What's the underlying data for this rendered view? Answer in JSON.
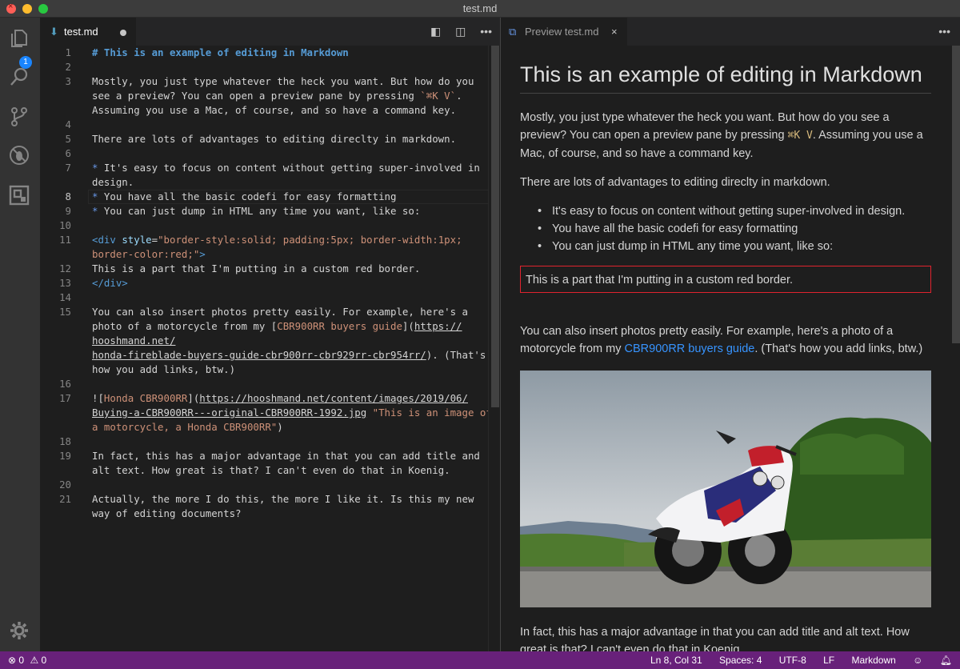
{
  "window": {
    "title": "test.md"
  },
  "activity_bar": {
    "explorer_badge": "1",
    "icons": [
      "files-icon",
      "search-icon",
      "source-control-icon",
      "debug-icon",
      "extensions-icon",
      "gear-icon"
    ]
  },
  "editor": {
    "tab": {
      "label": "test.md",
      "icon": "markdown-icon",
      "dirty": true
    },
    "actions": [
      "open-preview-side-icon",
      "split-editor-icon",
      "more-actions-icon"
    ],
    "current_line": "8",
    "lines": [
      {
        "n": "1",
        "segs": [
          {
            "c": "h1",
            "t": "# This is an example of editing in Markdown"
          }
        ]
      },
      {
        "n": "2",
        "segs": []
      },
      {
        "n": "3",
        "segs": [
          {
            "c": "",
            "t": "Mostly, you just type whatever the heck you want. But how do you"
          }
        ]
      },
      {
        "n": "",
        "segs": [
          {
            "c": "",
            "t": "see a preview? You can open a preview pane by pressing "
          },
          {
            "c": "codei",
            "t": "`⌘K V`"
          },
          {
            "c": "",
            "t": "."
          }
        ]
      },
      {
        "n": "",
        "segs": [
          {
            "c": "",
            "t": "Assuming you use a Mac, of course, and so have a command key."
          }
        ]
      },
      {
        "n": "4",
        "segs": []
      },
      {
        "n": "5",
        "segs": [
          {
            "c": "",
            "t": "There are lots of advantages to editing direclty in markdown."
          }
        ]
      },
      {
        "n": "6",
        "segs": []
      },
      {
        "n": "7",
        "segs": [
          {
            "c": "li",
            "t": "*"
          },
          {
            "c": "",
            "t": " It's easy to focus on content without getting super-involved in"
          }
        ]
      },
      {
        "n": "",
        "segs": [
          {
            "c": "",
            "t": "design."
          }
        ]
      },
      {
        "n": "8",
        "segs": [
          {
            "c": "li",
            "t": "*"
          },
          {
            "c": "",
            "t": " You have all the basic codefi for easy formatting"
          }
        ]
      },
      {
        "n": "9",
        "segs": [
          {
            "c": "li",
            "t": "*"
          },
          {
            "c": "",
            "t": " You can just dump in HTML any time you want, like so:"
          }
        ]
      },
      {
        "n": "10",
        "segs": []
      },
      {
        "n": "11",
        "segs": [
          {
            "c": "tag",
            "t": "<div"
          },
          {
            "c": "",
            "t": " "
          },
          {
            "c": "attr",
            "t": "style"
          },
          {
            "c": "",
            "t": "="
          },
          {
            "c": "str",
            "t": "\"border-style:solid; padding:5px; border-width:1px;"
          }
        ]
      },
      {
        "n": "",
        "segs": [
          {
            "c": "str",
            "t": "border-color:red;\""
          },
          {
            "c": "tag",
            "t": ">"
          }
        ]
      },
      {
        "n": "12",
        "segs": [
          {
            "c": "",
            "t": "This is a part that I'm putting in a custom red border."
          }
        ]
      },
      {
        "n": "13",
        "segs": [
          {
            "c": "tag",
            "t": "</div>"
          }
        ]
      },
      {
        "n": "14",
        "segs": []
      },
      {
        "n": "15",
        "segs": [
          {
            "c": "",
            "t": "You can also insert photos pretty easily. For example, here's a"
          }
        ]
      },
      {
        "n": "",
        "segs": [
          {
            "c": "",
            "t": "photo of a motorcycle from my ["
          },
          {
            "c": "str",
            "t": "CBR900RR buyers guide"
          },
          {
            "c": "",
            "t": "]("
          },
          {
            "c": "url",
            "t": "https://"
          }
        ]
      },
      {
        "n": "",
        "segs": [
          {
            "c": "url",
            "t": "hooshmand.net/"
          }
        ]
      },
      {
        "n": "",
        "segs": [
          {
            "c": "url",
            "t": "honda-fireblade-buyers-guide-cbr900rr-cbr929rr-cbr954rr/"
          },
          {
            "c": "",
            "t": "). (That's"
          }
        ]
      },
      {
        "n": "",
        "segs": [
          {
            "c": "",
            "t": "how you add links, btw.)"
          }
        ]
      },
      {
        "n": "16",
        "segs": []
      },
      {
        "n": "17",
        "segs": [
          {
            "c": "",
            "t": "!["
          },
          {
            "c": "str",
            "t": "Honda CBR900RR"
          },
          {
            "c": "",
            "t": "]("
          },
          {
            "c": "url",
            "t": "https://hooshmand.net/content/images/2019/06/"
          }
        ]
      },
      {
        "n": "",
        "segs": [
          {
            "c": "url",
            "t": "Buying-a-CBR900RR---original-CBR900RR-1992.jpg"
          },
          {
            "c": "",
            "t": " "
          },
          {
            "c": "str",
            "t": "\"This is an image of"
          }
        ]
      },
      {
        "n": "",
        "segs": [
          {
            "c": "str",
            "t": "a motorcycle, a Honda CBR900RR\""
          },
          {
            "c": "",
            "t": ")"
          }
        ]
      },
      {
        "n": "18",
        "segs": []
      },
      {
        "n": "19",
        "segs": [
          {
            "c": "",
            "t": "In fact, this has a major advantage in that you can add title and"
          }
        ]
      },
      {
        "n": "",
        "segs": [
          {
            "c": "",
            "t": "alt text. How great is that? I can't even do that in Koenig."
          }
        ]
      },
      {
        "n": "20",
        "segs": []
      },
      {
        "n": "21",
        "segs": [
          {
            "c": "",
            "t": "Actually, the more I do this, the more I like it. Is this my new"
          }
        ]
      },
      {
        "n": "",
        "segs": [
          {
            "c": "",
            "t": "way of editing documents?"
          }
        ]
      }
    ]
  },
  "preview": {
    "tab": {
      "label": "Preview test.md",
      "icon": "preview-icon"
    },
    "heading": "This is an example of editing in Markdown",
    "p1_a": "Mostly, you just type whatever the heck you want. But how do you see a preview? You can open a preview pane by pressing ",
    "p1_kbd": "⌘K V",
    "p1_b": ". Assuming you use a Mac, of course, and so have a command key.",
    "p2": "There are lots of advantages to editing direclty in markdown.",
    "bullets": [
      "It's easy to focus on content without getting super-involved in design.",
      "You have all the basic codefi for easy formatting",
      "You can just dump in HTML any time you want, like so:"
    ],
    "red_box": "This is a part that I'm putting in a custom red border.",
    "p3_a": "You can also insert photos pretty easily. For example, here's a photo of a motorcycle from my ",
    "p3_link": "CBR900RR buyers guide",
    "p3_b": ". (That's how you add links, btw.)",
    "p4": "In fact, this has a major advantage in that you can add title and alt text. How great is that? I can't even do that in Koenig."
  },
  "status": {
    "errors": "0",
    "warnings": "0",
    "position": "Ln 8, Col 31",
    "spaces": "Spaces: 4",
    "encoding": "UTF-8",
    "eol": "LF",
    "language": "Markdown"
  }
}
